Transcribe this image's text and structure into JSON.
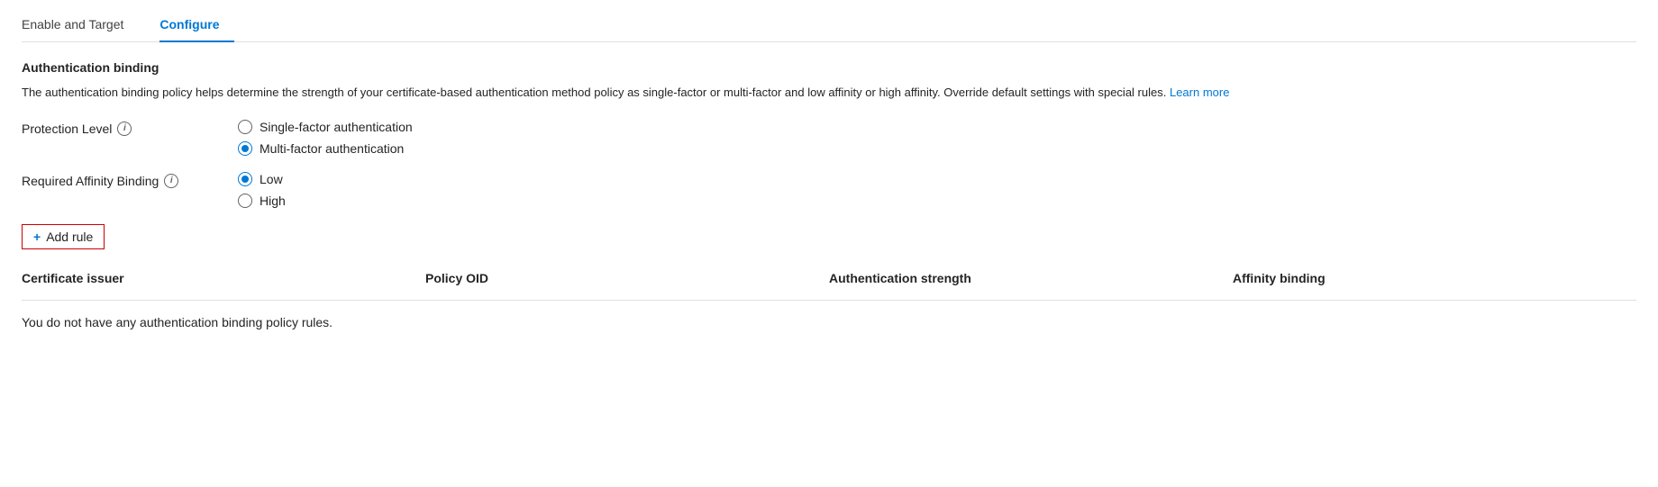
{
  "tabs": [
    {
      "id": "enable-target",
      "label": "Enable and Target",
      "active": false
    },
    {
      "id": "configure",
      "label": "Configure",
      "active": true
    }
  ],
  "section": {
    "title": "Authentication binding",
    "description": "The authentication binding policy helps determine the strength of your certificate-based authentication method policy as single-factor or multi-factor and low affinity or high affinity. Override default settings with special rules.",
    "learn_more": "Learn more"
  },
  "protection_level": {
    "label": "Protection Level",
    "options": [
      {
        "id": "single-factor",
        "label": "Single-factor authentication",
        "checked": false
      },
      {
        "id": "multi-factor",
        "label": "Multi-factor authentication",
        "checked": true
      }
    ]
  },
  "affinity_binding": {
    "label": "Required Affinity Binding",
    "options": [
      {
        "id": "low",
        "label": "Low",
        "checked": true
      },
      {
        "id": "high",
        "label": "High",
        "checked": false
      }
    ]
  },
  "add_rule_button": "+ Add rule",
  "table": {
    "columns": [
      {
        "id": "certificate-issuer",
        "label": "Certificate issuer"
      },
      {
        "id": "policy-oid",
        "label": "Policy OID"
      },
      {
        "id": "authentication-strength",
        "label": "Authentication strength"
      },
      {
        "id": "affinity-binding",
        "label": "Affinity binding"
      }
    ],
    "empty_message": "You do not have any authentication binding policy rules."
  }
}
